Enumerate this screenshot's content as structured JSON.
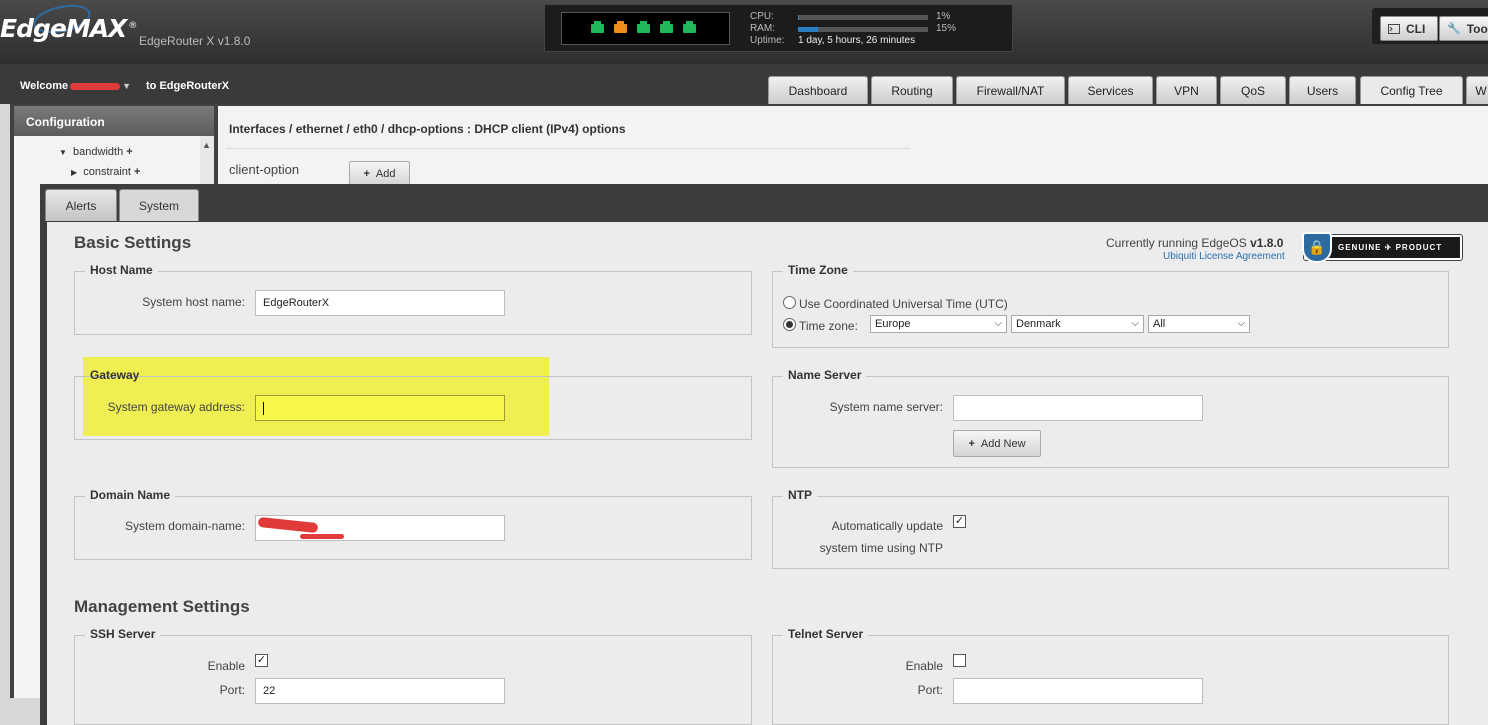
{
  "header": {
    "logo": "EdgeMAX",
    "logo_mark": "®",
    "version": "EdgeRouter X v1.8.0",
    "ports": [
      {
        "status": "up",
        "color": "#1fb85a"
      },
      {
        "status": "active",
        "color": "#f08c1a"
      },
      {
        "status": "up",
        "color": "#1fb85a"
      },
      {
        "status": "up",
        "color": "#1fb85a"
      },
      {
        "status": "up",
        "color": "#1fb85a"
      }
    ],
    "cpu_label": "CPU:",
    "cpu_pct": "1%",
    "cpu_value": 0.01,
    "ram_label": "RAM:",
    "ram_pct": "15%",
    "ram_value": 0.15,
    "uptime_label": "Uptime:",
    "uptime_value": "1 day, 5 hours, 26 minutes",
    "cli_label": "CLI",
    "tools_label": "Too",
    "cli_icon": "terminal-icon",
    "tools_icon": "wrench-icon"
  },
  "nav": {
    "welcome": "Welcome",
    "welcome_to": "to EdgeRouterX",
    "tabs": [
      "Dashboard",
      "Routing",
      "Firewall/NAT",
      "Services",
      "VPN",
      "QoS",
      "Users",
      "Config Tree",
      "W"
    ],
    "active_tab": "Config Tree"
  },
  "tree": {
    "title": "Configuration",
    "items": [
      {
        "label": "bandwidth",
        "expanded": true
      },
      {
        "label": "constraint",
        "expanded": false
      }
    ]
  },
  "detail": {
    "breadcrumb": "Interfaces / ethernet / eth0 / dhcp-options : DHCP client (IPv4) options",
    "client_option_label": "client-option",
    "add_label": "Add"
  },
  "system": {
    "tabs": [
      "Alerts",
      "System"
    ],
    "active_tab": "System",
    "basic_title": "Basic Settings",
    "running_text": "Currently running EdgeOS",
    "running_version": "v1.8.0",
    "license_link": "Ubiquiti License Agreement",
    "badge_text": "GENUINE ✈ PRODUCT",
    "host": {
      "legend": "Host Name",
      "label": "System host name:",
      "value": "EdgeRouterX"
    },
    "gateway": {
      "legend": "Gateway",
      "label": "System gateway address:",
      "value": ""
    },
    "domain": {
      "legend": "Domain Name",
      "label": "System domain-name:",
      "value": ""
    },
    "timezone": {
      "legend": "Time Zone",
      "utc_label": "Use Coordinated Universal Time (UTC)",
      "tz_label": "Time zone:",
      "selected": "timezone",
      "region": "Europe",
      "country": "Denmark",
      "zone": "All"
    },
    "nameserver": {
      "legend": "Name Server",
      "label": "System name server:",
      "value": "",
      "add_new": "Add New"
    },
    "ntp": {
      "legend": "NTP",
      "label_line1": "Automatically update",
      "label_line2": "system time using NTP",
      "checked": true
    },
    "mgmt_title": "Management Settings",
    "ssh": {
      "legend": "SSH Server",
      "enable_label": "Enable",
      "enabled": true,
      "port_label": "Port:",
      "port": "22"
    },
    "telnet": {
      "legend": "Telnet Server",
      "enable_label": "Enable",
      "enabled": false,
      "port_label": "Port:",
      "port": ""
    }
  }
}
